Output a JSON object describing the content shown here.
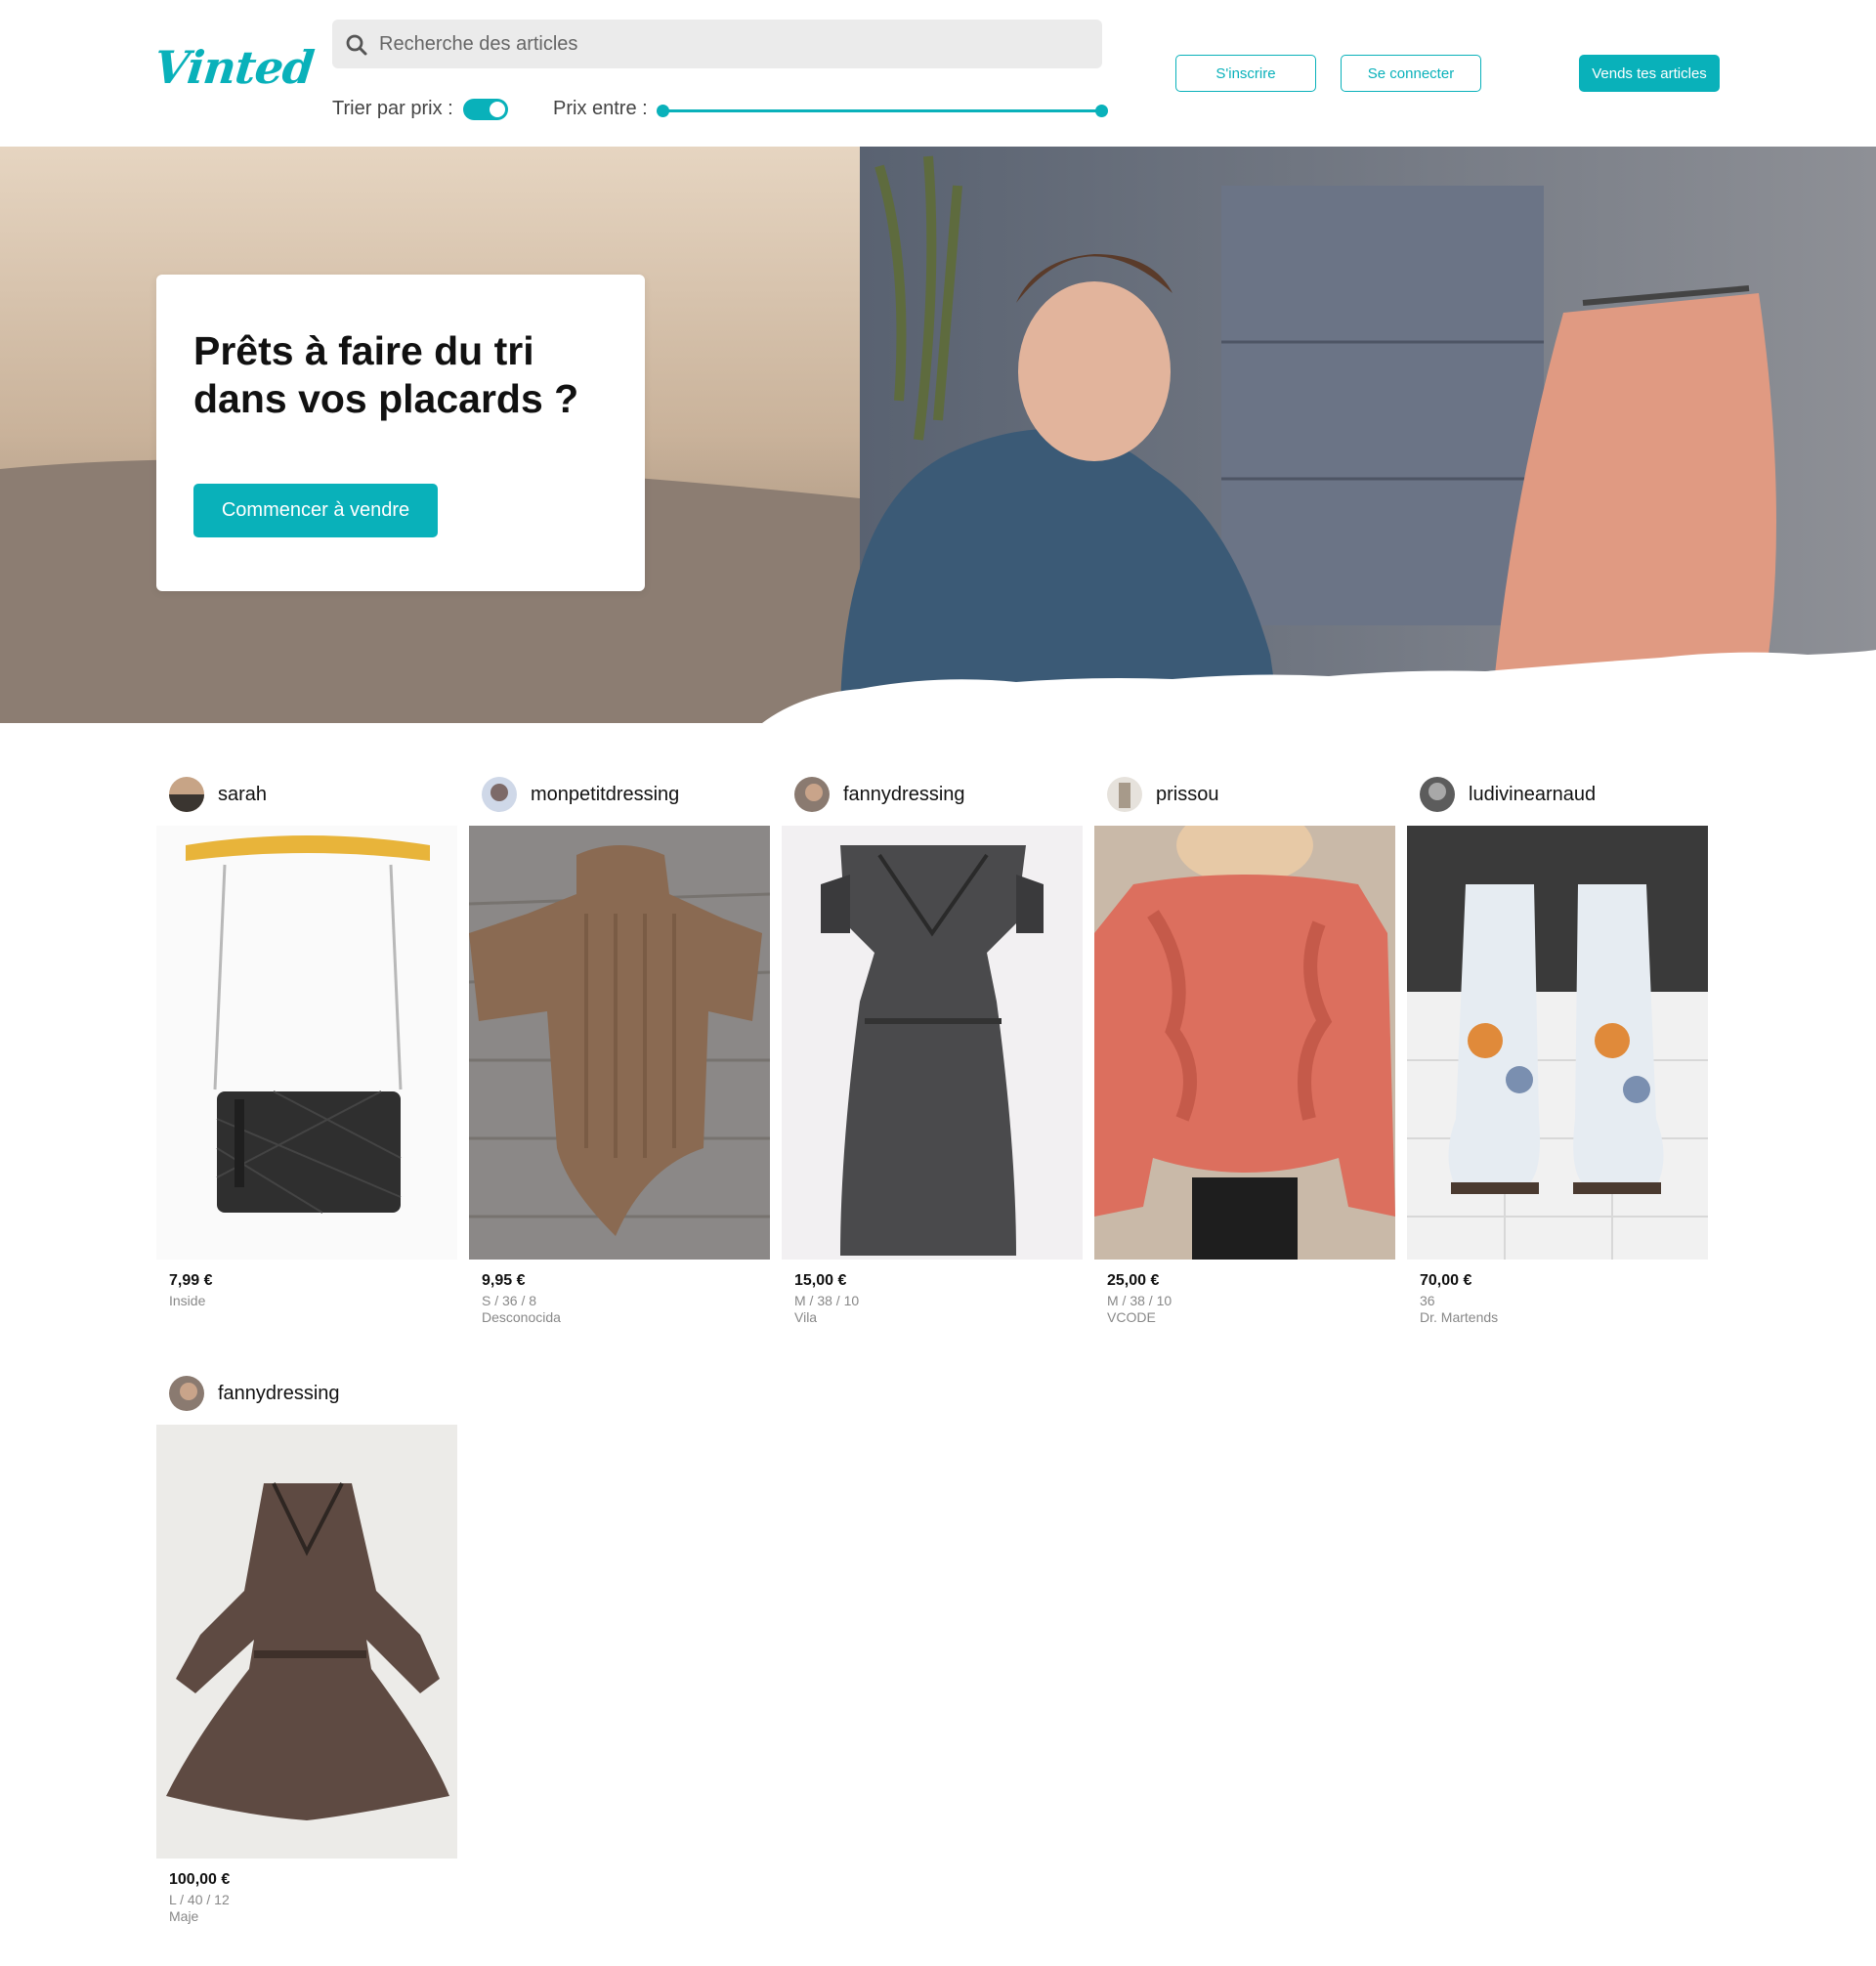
{
  "header": {
    "logo": "Vinted",
    "search_placeholder": "Recherche des articles",
    "sort_label": "Trier par prix :",
    "sort_enabled": true,
    "price_label": "Prix entre :",
    "price_range": {
      "min": 0,
      "max": 1
    },
    "signup_label": "S'inscrire",
    "login_label": "Se connecter",
    "sell_label": "Vends tes articles"
  },
  "hero": {
    "title": "Prêts à faire du tri dans vos placards ?",
    "cta_label": "Commencer à vendre"
  },
  "items": [
    {
      "user": "sarah",
      "price": "7,99 €",
      "size": "",
      "brand": "Inside",
      "photo": "bag-icon"
    },
    {
      "user": "monpetitdressing",
      "price": "9,95 €",
      "size": "S / 36 / 8",
      "brand": "Desconocida",
      "photo": "sweater-icon"
    },
    {
      "user": "fannydressing",
      "price": "15,00 €",
      "size": "M / 38 / 10",
      "brand": "Vila",
      "photo": "dress-icon"
    },
    {
      "user": "prissou",
      "price": "25,00 €",
      "size": "M / 38 / 10",
      "brand": "VCODE",
      "photo": "ruffle-sweater-icon"
    },
    {
      "user": "ludivinearnaud",
      "price": "70,00 €",
      "size": "36",
      "brand": "Dr. Martends",
      "photo": "boots-icon"
    },
    {
      "user": "fannydressing",
      "price": "100,00 €",
      "size": "L / 40 / 12",
      "brand": "Maje",
      "photo": "floral-dress-icon"
    }
  ],
  "colors": {
    "accent": "#09b1ba",
    "text": "#111111",
    "muted": "#888888",
    "search_bg": "#ebebeb"
  }
}
